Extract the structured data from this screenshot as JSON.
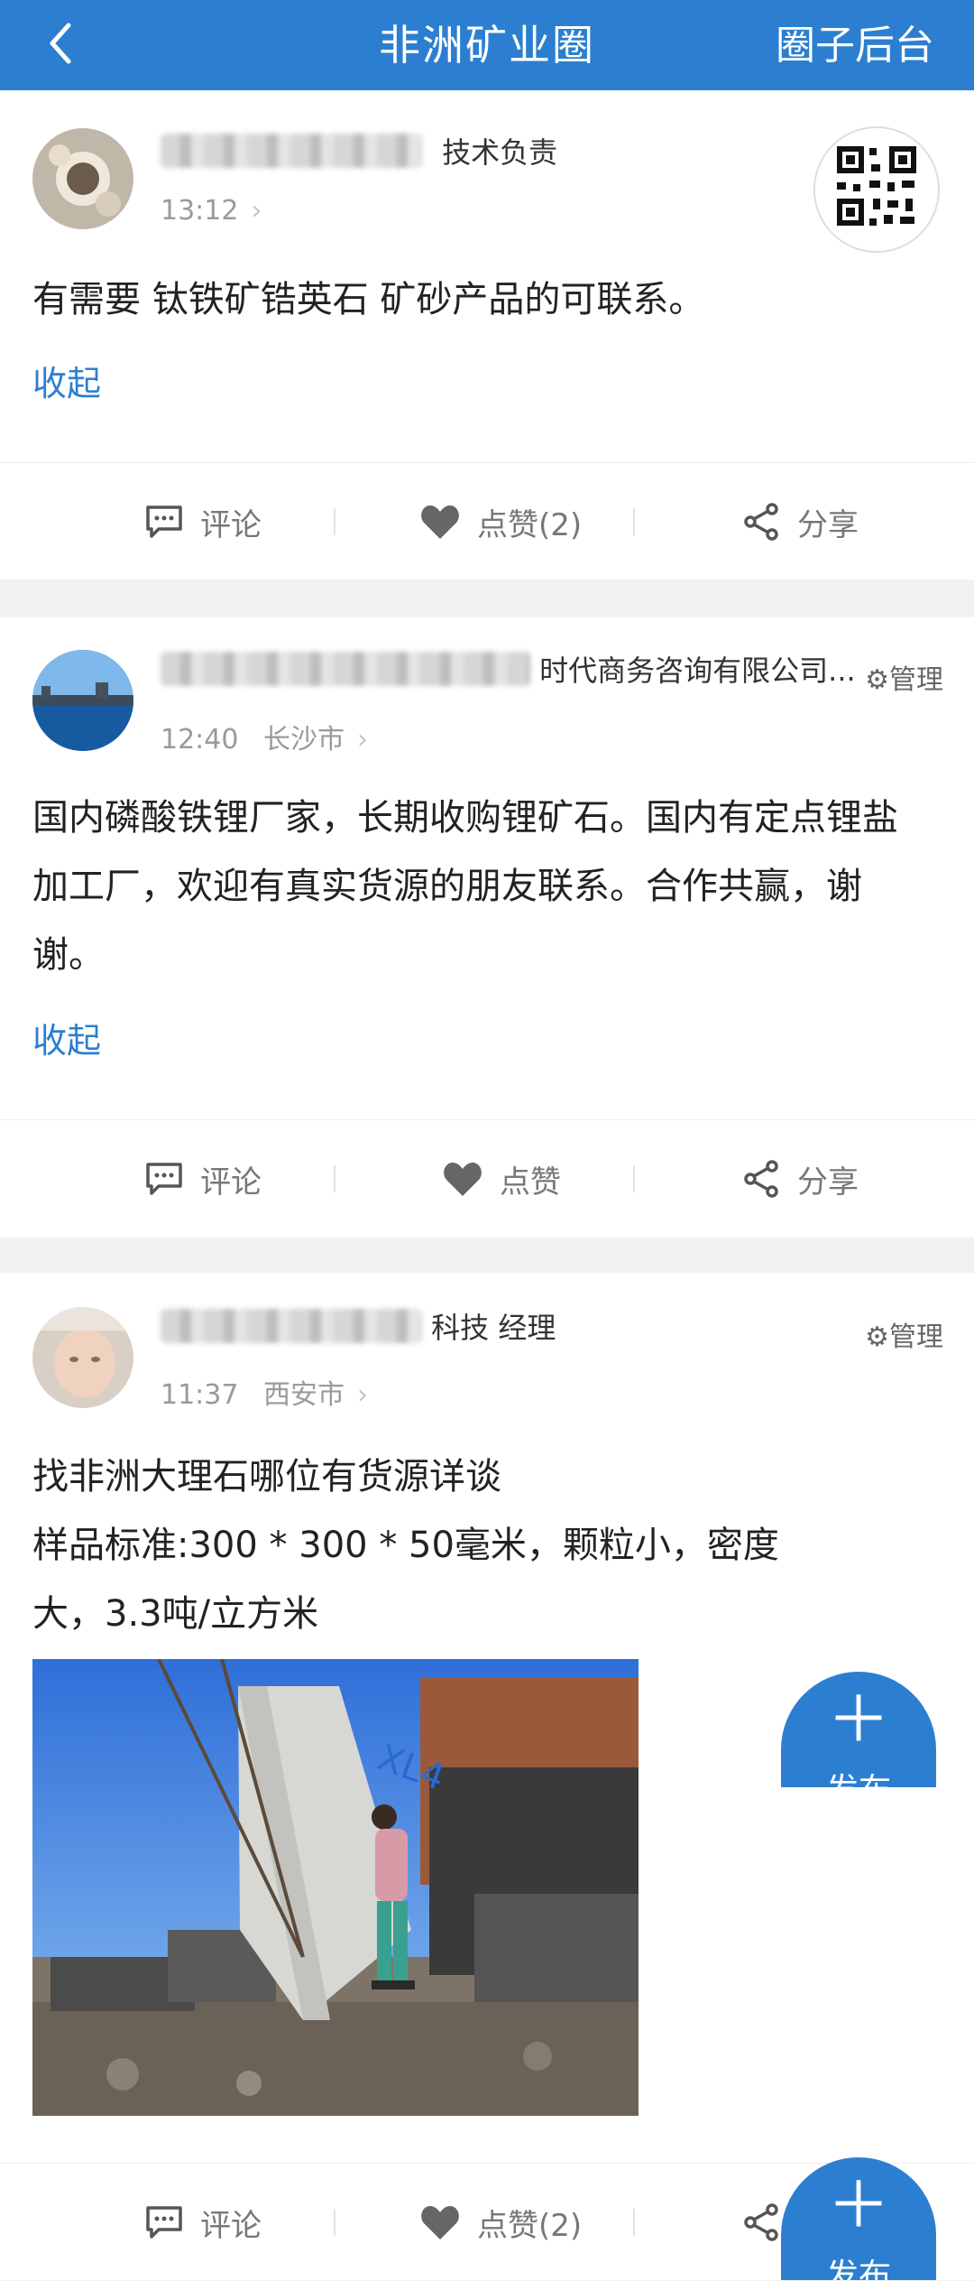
{
  "header": {
    "title": "非洲矿业圈",
    "admin_label": "圈子后台"
  },
  "posts": [
    {
      "role": "技术负责",
      "time": "13:12",
      "city": "",
      "content": "有需要 钛铁矿锆英石 矿砂产品的可联系。",
      "collapse": "收起",
      "manage": "",
      "comment": "评论",
      "like": "点赞(2)",
      "share": "分享"
    },
    {
      "role": "时代商务咨询有限公司...",
      "time": "12:40",
      "city": "长沙市",
      "content": "国内磷酸铁锂厂家，长期收购锂矿石。国内有定点锂盐加工厂，欢迎有真实货源的朋友联系。合作共赢，谢谢。",
      "collapse": "收起",
      "manage": "管理",
      "comment": "评论",
      "like": "点赞",
      "share": "分享"
    },
    {
      "role": "科技 经理",
      "time": "11:37",
      "city": "西安市",
      "content_lines": [
        "找非洲大理石哪位有货源详谈",
        "样品标准:300 * 300 * 50毫米，颗粒小，密度",
        "大，3.3吨/立方米"
      ],
      "photo_text": "XL4",
      "manage": "管理",
      "comment": "评论",
      "like": "点赞(2)",
      "share": "分享"
    }
  ],
  "fab": {
    "label": "发布"
  },
  "colors": {
    "brand": "#2c7fd0",
    "link": "#2c7fd0"
  }
}
